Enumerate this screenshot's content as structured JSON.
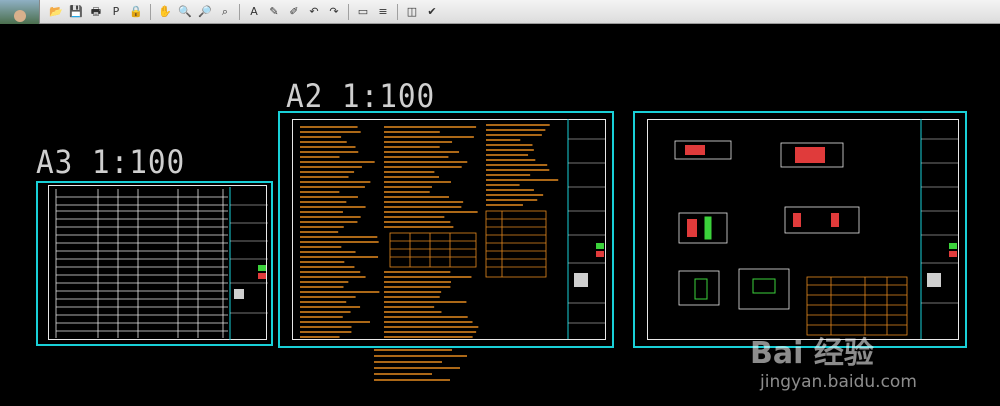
{
  "toolbar": {
    "avatar": "user-avatar",
    "buttons": [
      {
        "name": "open-button",
        "glyph": "📂"
      },
      {
        "name": "save-button",
        "glyph": "💾"
      },
      {
        "name": "print-button",
        "glyph": "🖶"
      },
      {
        "name": "pdf-button",
        "glyph": "P"
      },
      {
        "name": "lock-button",
        "glyph": "🔒"
      },
      {
        "sep": true
      },
      {
        "name": "pan-button",
        "glyph": "✋"
      },
      {
        "name": "zoom-in-button",
        "glyph": "🔍"
      },
      {
        "name": "zoom-out-button",
        "glyph": "🔎"
      },
      {
        "name": "zoom-extents-button",
        "glyph": "⌕"
      },
      {
        "sep": true
      },
      {
        "name": "text-button",
        "glyph": "A"
      },
      {
        "name": "pencil-button",
        "glyph": "✎"
      },
      {
        "name": "highlight-button",
        "glyph": "✐"
      },
      {
        "name": "undo-button",
        "glyph": "↶"
      },
      {
        "name": "redo-button",
        "glyph": "↷"
      },
      {
        "sep": true
      },
      {
        "name": "measure-button",
        "glyph": "▭"
      },
      {
        "name": "scale-button",
        "glyph": "≡"
      },
      {
        "sep": true
      },
      {
        "name": "layers-button",
        "glyph": "◫"
      },
      {
        "name": "check-button",
        "glyph": "✔"
      }
    ]
  },
  "sheets": {
    "a3_label": "A3 1:100",
    "a2_label": "A2 1:100"
  },
  "watermark": {
    "brand": "Bai 经验",
    "url": "jingyan.baidu.com"
  },
  "colors": {
    "frame": "#19d0d8",
    "inner": "#e8e8e8",
    "text_lines": "#e68a1f"
  }
}
